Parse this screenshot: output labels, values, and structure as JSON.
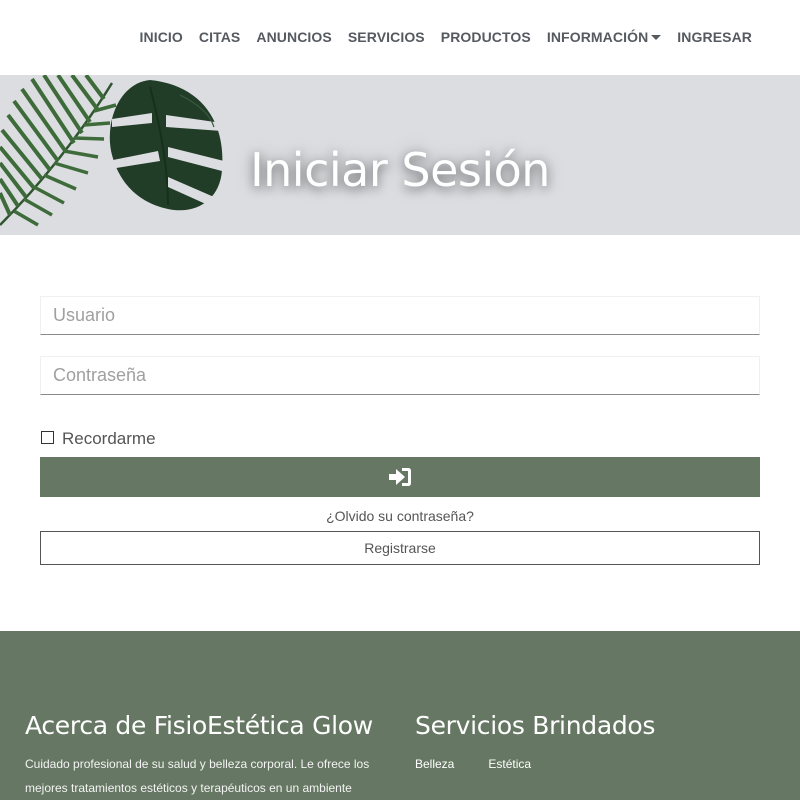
{
  "nav": {
    "items": [
      {
        "label": "INICIO"
      },
      {
        "label": "CITAS"
      },
      {
        "label": "ANUNCIOS"
      },
      {
        "label": "SERVICIOS"
      },
      {
        "label": "PRODUCTOS"
      },
      {
        "label": "INFORMACIÓN",
        "has_dropdown": true
      },
      {
        "label": "INGRESAR"
      }
    ]
  },
  "hero": {
    "title": "Iniciar Sesión",
    "background_color": "#dcdde1"
  },
  "form": {
    "username_placeholder": "Usuario",
    "password_placeholder": "Contraseña",
    "remember_label": "Recordarme",
    "remember_checked": false,
    "login_icon": "sign-in-icon",
    "forgot_label": "¿Olvido su contraseña?",
    "register_label": "Registrarse"
  },
  "footer": {
    "about_title": "Acerca de FisioEstética Glow",
    "about_text": "Cuidado profesional de su salud y belleza corporal. Le ofrece los mejores tratamientos estéticos y terapéuticos en un ambiente",
    "services_title": "Servicios Brindados",
    "services": [
      "Belleza",
      "Estética"
    ]
  },
  "colors": {
    "accent_green": "#667863",
    "nav_text": "#555a60",
    "hero_gray": "#dcdde1"
  }
}
